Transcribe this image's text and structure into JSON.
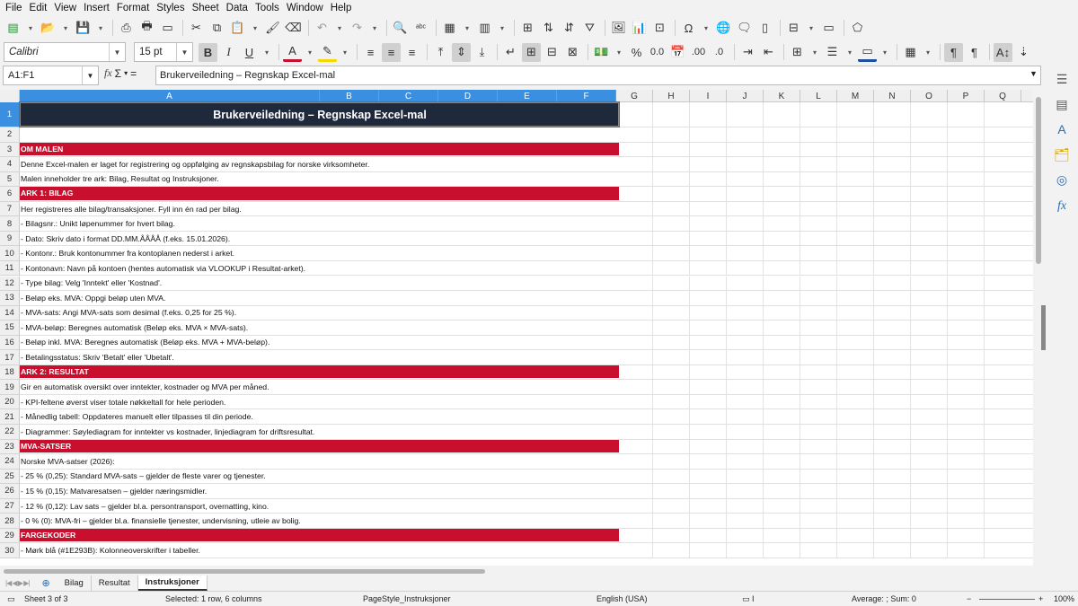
{
  "menu": [
    "File",
    "Edit",
    "View",
    "Insert",
    "Format",
    "Styles",
    "Sheet",
    "Data",
    "Tools",
    "Window",
    "Help"
  ],
  "font": {
    "name": "Calibri",
    "size": "15 pt"
  },
  "namebox": "A1:F1",
  "formula": "Brukerveiledning – Regnskap Excel-mal",
  "columns": [
    "A",
    "B",
    "C",
    "D",
    "E",
    "F",
    "G",
    "H",
    "I",
    "J",
    "K",
    "L",
    "M",
    "N",
    "O",
    "P",
    "Q"
  ],
  "rows": [
    {
      "n": "1",
      "type": "title",
      "text": "Brukerveiledning – Regnskap Excel-mal"
    },
    {
      "n": "2",
      "type": "normal",
      "text": ""
    },
    {
      "n": "3",
      "type": "sec",
      "text": "OM MALEN"
    },
    {
      "n": "4",
      "type": "normal",
      "text": "Denne Excel-malen er laget for registrering og oppfølging av regnskapsbilag for norske virksomheter."
    },
    {
      "n": "5",
      "type": "normal",
      "text": "Malen inneholder tre ark: Bilag, Resultat og Instruksjoner."
    },
    {
      "n": "6",
      "type": "sec",
      "text": "ARK 1: BILAG"
    },
    {
      "n": "7",
      "type": "normal",
      "text": "Her registreres alle bilag/transaksjoner. Fyll inn én rad per bilag."
    },
    {
      "n": "8",
      "type": "normal",
      "text": "- Bilagsnr.: Unikt løpenummer for hvert bilag."
    },
    {
      "n": "9",
      "type": "normal",
      "text": "- Dato: Skriv dato i format DD.MM.ÅÅÅÅ (f.eks. 15.01.2026)."
    },
    {
      "n": "10",
      "type": "normal",
      "text": "- Kontonr.: Bruk kontonummer fra kontoplanen nederst i arket."
    },
    {
      "n": "11",
      "type": "normal",
      "text": "- Kontonavn: Navn på kontoen (hentes automatisk via VLOOKUP i Resultat-arket)."
    },
    {
      "n": "12",
      "type": "normal",
      "text": "- Type bilag: Velg 'Inntekt' eller 'Kostnad'."
    },
    {
      "n": "13",
      "type": "normal",
      "text": "- Beløp eks. MVA: Oppgi beløp uten MVA."
    },
    {
      "n": "14",
      "type": "normal",
      "text": "- MVA-sats: Angi MVA-sats som desimal (f.eks. 0,25 for 25 %)."
    },
    {
      "n": "15",
      "type": "normal",
      "text": "- MVA-beløp: Beregnes automatisk (Beløp eks. MVA × MVA-sats)."
    },
    {
      "n": "16",
      "type": "normal",
      "text": "- Beløp inkl. MVA: Beregnes automatisk (Beløp eks. MVA + MVA-beløp)."
    },
    {
      "n": "17",
      "type": "normal",
      "text": "- Betalingsstatus: Skriv 'Betalt' eller 'Ubetalt'."
    },
    {
      "n": "18",
      "type": "sec",
      "text": "ARK 2: RESULTAT"
    },
    {
      "n": "19",
      "type": "normal",
      "text": "Gir en automatisk oversikt over inntekter, kostnader og MVA per måned."
    },
    {
      "n": "20",
      "type": "normal",
      "text": "- KPI-feltene øverst viser totale nøkkeltall for hele perioden."
    },
    {
      "n": "21",
      "type": "normal",
      "text": "- Månedlig tabell: Oppdateres manuelt eller tilpasses til din periode."
    },
    {
      "n": "22",
      "type": "normal",
      "text": "- Diagrammer: Søylediagram for inntekter vs kostnader, linjediagram for driftsresultat."
    },
    {
      "n": "23",
      "type": "sec",
      "text": "MVA-SATSER"
    },
    {
      "n": "24",
      "type": "normal",
      "text": "Norske MVA-satser (2026):"
    },
    {
      "n": "25",
      "type": "normal",
      "text": "- 25 % (0,25): Standard MVA-sats – gjelder de fleste varer og tjenester."
    },
    {
      "n": "26",
      "type": "normal",
      "text": "- 15 % (0,15): Matvaresatsen – gjelder næringsmidler."
    },
    {
      "n": "27",
      "type": "normal",
      "text": "- 12 % (0,12): Lav sats – gjelder bl.a. persontransport, overnatting, kino."
    },
    {
      "n": "28",
      "type": "normal",
      "text": "- 0 % (0): MVA-fri – gjelder bl.a. finansielle tjenester, undervisning, utleie av bolig."
    },
    {
      "n": "29",
      "type": "sec",
      "text": "FARGEKODER"
    },
    {
      "n": "30",
      "type": "normal",
      "text": "- Mørk blå (#1E293B): Kolonneoverskrifter i tabeller."
    }
  ],
  "tabs": [
    "Bilag",
    "Resultat",
    "Instruksjoner"
  ],
  "active_tab": "Instruksjoner",
  "status": {
    "sheet": "Sheet 3 of 3",
    "selection": "Selected: 1 row, 6 columns",
    "pagestyle": "PageStyle_Instruksjoner",
    "language": "English (USA)",
    "summary": "Average: ; Sum: 0",
    "zoom": "100%"
  },
  "colors": {
    "title_bg": "#1E293B",
    "section_bg": "#C8102E",
    "selection": "#3B8FE0"
  }
}
